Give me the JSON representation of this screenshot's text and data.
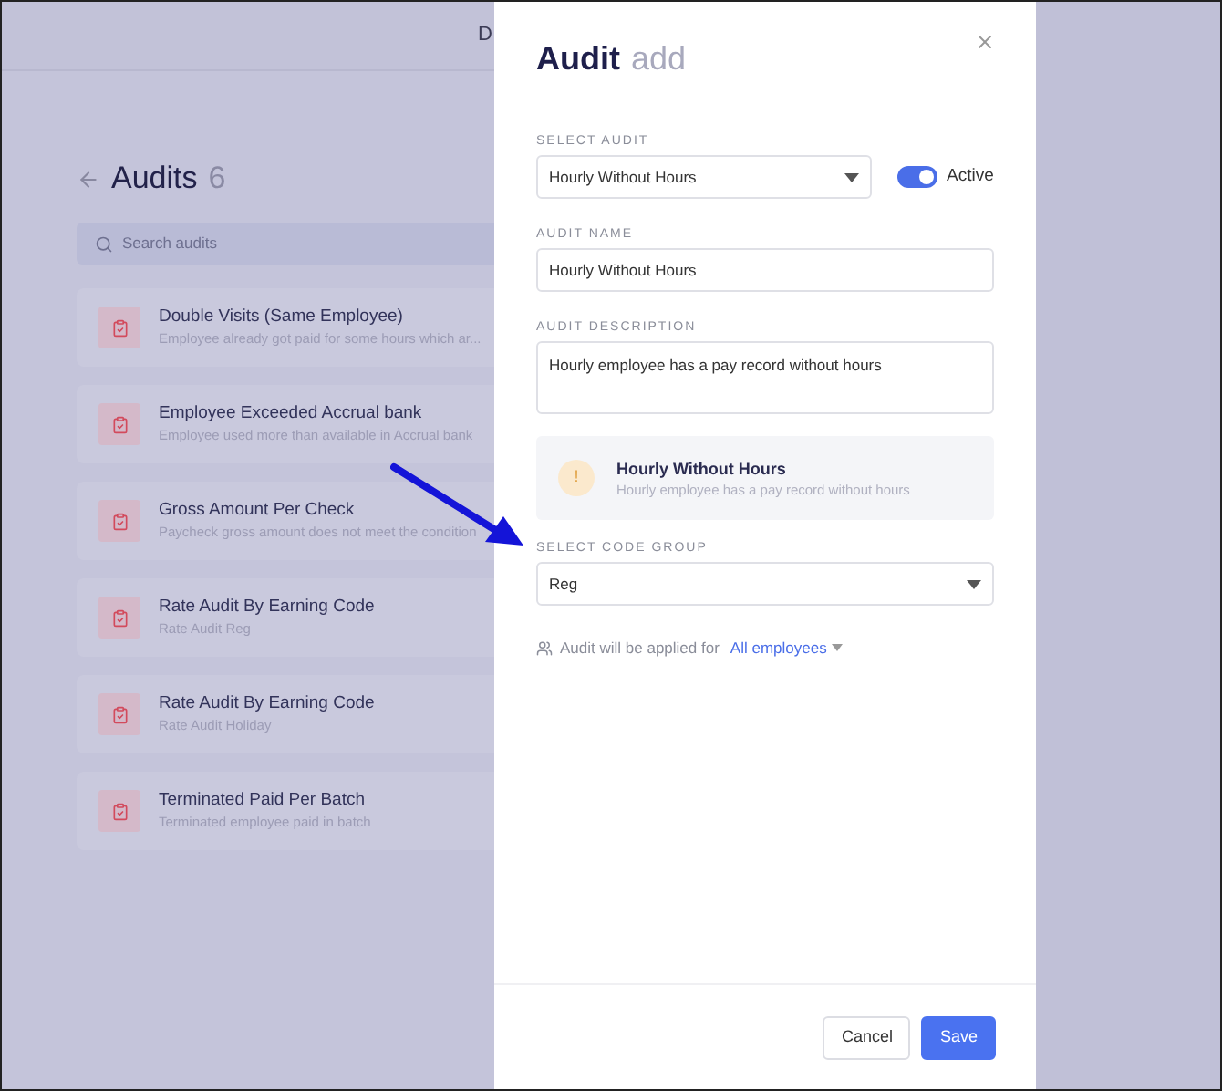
{
  "page": {
    "header_text": "D",
    "title": "Audits",
    "count": "6",
    "search": {
      "placeholder": "Search audits"
    },
    "audits": [
      {
        "name": "Double Visits (Same Employee)",
        "description": "Employee already got paid for some hours which ar..."
      },
      {
        "name": "Employee Exceeded Accrual bank",
        "description": "Employee used more than available in Accrual bank"
      },
      {
        "name": "Gross Amount Per Check",
        "description": "Paycheck gross amount does not meet the condition"
      },
      {
        "name": "Rate Audit By Earning Code",
        "description": "Rate Audit Reg"
      },
      {
        "name": "Rate Audit By Earning Code",
        "description": "Rate Audit Holiday"
      },
      {
        "name": "Terminated Paid Per Batch",
        "description": "Terminated employee paid in batch"
      }
    ]
  },
  "modal": {
    "title": "Audit",
    "title_suffix": "add",
    "select_audit": {
      "label": "SELECT AUDIT",
      "value": "Hourly Without Hours"
    },
    "active": {
      "label": "Active",
      "on": true
    },
    "audit_name": {
      "label": "AUDIT NAME",
      "value": "Hourly Without Hours"
    },
    "audit_description": {
      "label": "AUDIT DESCRIPTION",
      "value": "Hourly employee has a pay record without hours"
    },
    "info": {
      "title": "Hourly Without Hours",
      "description": "Hourly employee has a pay record without hours",
      "icon": "!"
    },
    "code_group": {
      "label": "SELECT CODE GROUP",
      "value": "Reg"
    },
    "applied": {
      "text": "Audit will be applied for",
      "link": "All employees"
    },
    "buttons": [
      {
        "label": "Cancel",
        "kind": "secondary"
      },
      {
        "label": "Save",
        "kind": "primary"
      }
    ]
  }
}
